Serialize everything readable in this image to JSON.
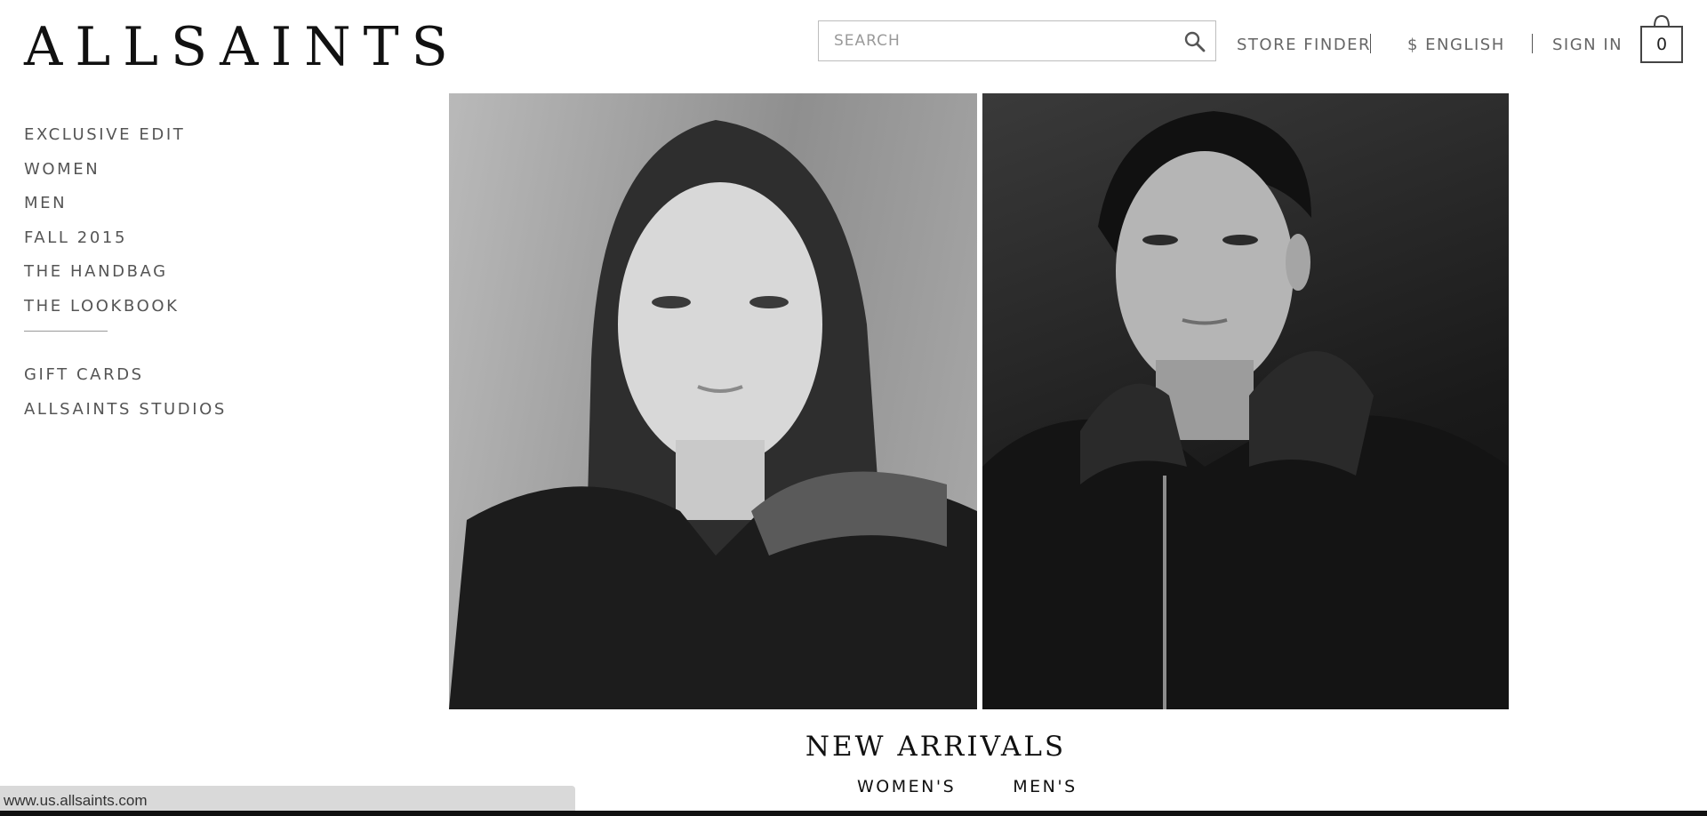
{
  "header": {
    "logo": "ALLSAINTS",
    "search": {
      "placeholder": "SEARCH",
      "value": ""
    },
    "nav": {
      "store_finder": "STORE FINDER",
      "currency_language": "$ ENGLISH",
      "sign_in": "SIGN IN"
    },
    "bag": {
      "count": "0",
      "icon": "shopping-bag-icon"
    }
  },
  "sidebar": {
    "primary": [
      {
        "label": "EXCLUSIVE EDIT"
      },
      {
        "label": "WOMEN"
      },
      {
        "label": "MEN"
      },
      {
        "label": "FALL 2015"
      },
      {
        "label": "THE HANDBAG"
      },
      {
        "label": "THE LOOKBOOK"
      }
    ],
    "secondary": [
      {
        "label": "GIFT CARDS"
      },
      {
        "label": "ALLSAINTS STUDIOS"
      }
    ]
  },
  "hero": {
    "left_image": "woman-portrait-photo",
    "right_image": "man-portrait-photo"
  },
  "section": {
    "title": "NEW ARRIVALS",
    "links": {
      "women": "WOMEN'S",
      "men": "MEN'S"
    }
  },
  "status_bar": {
    "url": "www.us.allsaints.com"
  },
  "colors": {
    "text": "#222222",
    "nav_grey": "#666666",
    "status_bg": "#d9d9d9"
  }
}
